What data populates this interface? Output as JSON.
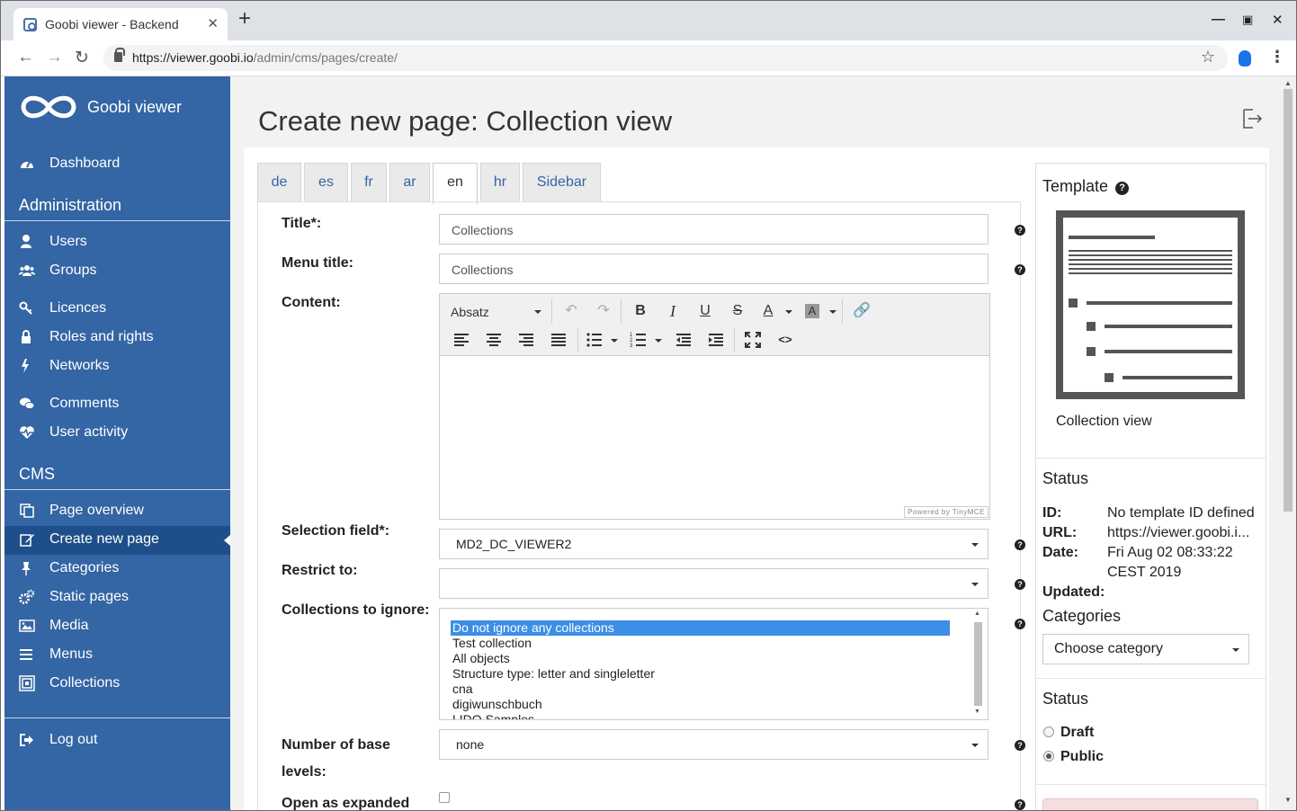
{
  "browser": {
    "tab_title": "Goobi viewer - Backend",
    "url_host": "https://viewer.goobi.io",
    "url_path": "/admin/cms/pages/create/"
  },
  "sidebar": {
    "brand": "Goobi viewer",
    "dashboard": "Dashboard",
    "admin_heading": "Administration",
    "admin_items": [
      "Users",
      "Groups",
      "Licences",
      "Roles and rights",
      "Networks",
      "Comments",
      "User activity"
    ],
    "cms_heading": "CMS",
    "cms_items": [
      "Page overview",
      "Create new page",
      "Categories",
      "Static pages",
      "Media",
      "Menus",
      "Collections"
    ],
    "logout": "Log out",
    "active_item": "Create new page"
  },
  "page": {
    "title": "Create new page: Collection view"
  },
  "lang_tabs": [
    "de",
    "es",
    "fr",
    "ar",
    "en",
    "hr",
    "Sidebar"
  ],
  "active_lang_tab": "en",
  "form": {
    "title_label": "Title*:",
    "title_value": "Collections",
    "menu_title_label": "Menu title:",
    "menu_title_value": "Collections",
    "content_label": "Content:",
    "editor_format": "Absatz",
    "powered_by": "Powered by TinyMCE",
    "selection_field_label": "Selection field*:",
    "selection_field_value": "MD2_DC_VIEWER2",
    "restrict_label": "Restrict to:",
    "restrict_value": "",
    "ignore_label": "Collections to ignore:",
    "ignore_options": [
      "Do not ignore any collections",
      "Test collection",
      "All objects",
      "Structure type: letter and singleletter",
      "cna",
      "digiwunschbuch",
      "LIDO Samples"
    ],
    "ignore_selected": "Do not ignore any collections",
    "base_levels_label_1": "Number of base",
    "base_levels_label_2": "levels:",
    "base_levels_value": "none",
    "expanded_label": "Open as expanded"
  },
  "right": {
    "template_title": "Template",
    "template_name": "Collection view",
    "status_title": "Status",
    "id_label": "ID:",
    "id_value": "No template ID defined",
    "url_label": "URL:",
    "url_value": "https://viewer.goobi.i...",
    "date_label": "Date:",
    "date_value_1": "Fri Aug 02 08:33:22",
    "date_value_2": "CEST 2019",
    "updated_label": "Updated:",
    "categories_title": "Categories",
    "category_select": "Choose category",
    "status2_title": "Status",
    "draft": "Draft",
    "public": "Public",
    "selected_status": "Public"
  },
  "colors": {
    "sidebar_bg": "#3465a4",
    "sidebar_active": "#1f4f8a",
    "link": "#3465a4",
    "list_selected": "#3c8ee6"
  }
}
